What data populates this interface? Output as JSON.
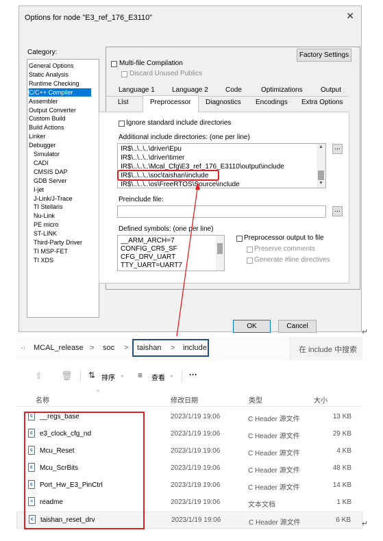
{
  "dialog": {
    "title": "Options for node \"E3_ref_176_E3110\"",
    "category_label": "Category:",
    "categories": [
      {
        "label": "General Options",
        "sub": false
      },
      {
        "label": "Static Analysis",
        "sub": false
      },
      {
        "label": "Runtime Checking",
        "sub": false
      },
      {
        "label": "C/C++ Compiler",
        "sub": false,
        "selected": true
      },
      {
        "label": "Assembler",
        "sub": false
      },
      {
        "label": "Output Converter",
        "sub": false
      },
      {
        "label": "Custom Build",
        "sub": false
      },
      {
        "label": "Build Actions",
        "sub": false
      },
      {
        "label": "Linker",
        "sub": false
      },
      {
        "label": "Debugger",
        "sub": false
      },
      {
        "label": "Simulator",
        "sub": true
      },
      {
        "label": "CADI",
        "sub": true
      },
      {
        "label": "CMSIS DAP",
        "sub": true
      },
      {
        "label": "GDB Server",
        "sub": true
      },
      {
        "label": "I-jet",
        "sub": true
      },
      {
        "label": "J-Link/J-Trace",
        "sub": true
      },
      {
        "label": "TI Stellaris",
        "sub": true
      },
      {
        "label": "Nu-Link",
        "sub": true
      },
      {
        "label": "PE micro",
        "sub": true
      },
      {
        "label": "ST-LINK",
        "sub": true
      },
      {
        "label": "Third-Party Driver",
        "sub": true
      },
      {
        "label": "TI MSP-FET",
        "sub": true
      },
      {
        "label": "TI XDS",
        "sub": true
      }
    ],
    "factory_settings": "Factory Settings",
    "multi_file": "Multi-file Compilation",
    "discard_unused": "Discard Unused Publics",
    "tabs_row1": [
      "Language 1",
      "Language 2",
      "Code",
      "Optimizations",
      "Output"
    ],
    "tabs_row2": [
      "List",
      "Preprocessor",
      "Diagnostics",
      "Encodings",
      "Extra Options"
    ],
    "ignore_std": "Ignore standard include directories",
    "include_label": "Additional include directories: (one per line)",
    "include_lines": [
      "IR$\\..\\..\\..\\driver\\Epu",
      "IR$\\..\\..\\..\\driver\\timer",
      "IR$\\..\\..\\..\\Mcal_Cfg\\E3_ref_176_E3110\\output\\include",
      "IR$\\..\\..\\..\\soc\\taishan\\include",
      "IR$\\..\\..\\..\\os\\FreeRTOS\\Source\\include"
    ],
    "ellipsis": "...",
    "preinclude_label": "Preinclude file:",
    "defined_label": "Defined symbols: (one per line)",
    "defined_lines": [
      "__ARM_ARCH=7",
      "CONFIG_CR5_SF",
      "CFG_DRV_UART",
      "TTY_UART=UART7"
    ],
    "pp_output": "Preprocessor output to file",
    "preserve_comments": "Preserve comments",
    "generate_line": "Generate #line directives",
    "ok": "OK",
    "cancel": "Cancel"
  },
  "explorer": {
    "breadcrumb": [
      "MCAL_release",
      "soc",
      "taishan",
      "include"
    ],
    "breadcrumb_more": "··",
    "separator": ">",
    "search_placeholder": "在 include 中搜索",
    "toolbar": {
      "sort": "排序",
      "view": "查看",
      "more": "···"
    },
    "columns": {
      "name": "名称",
      "date": "修改日期",
      "type": "类型",
      "size": "大小"
    },
    "files": [
      {
        "name": "__regs_base",
        "date": "2023/1/19 19:06",
        "type": "C Header 源文件",
        "size": "13 KB",
        "icon": "c-file-icon"
      },
      {
        "name": "e3_clock_cfg_nd",
        "date": "2023/1/19 19:06",
        "type": "C Header 源文件",
        "size": "29 KB",
        "icon": "c-file-icon"
      },
      {
        "name": "Mcu_Reset",
        "date": "2023/1/19 19:06",
        "type": "C Header 源文件",
        "size": "4 KB",
        "icon": "c-file-icon"
      },
      {
        "name": "Mcu_ScrBits",
        "date": "2023/1/19 19:06",
        "type": "C Header 源文件",
        "size": "48 KB",
        "icon": "c-file-icon"
      },
      {
        "name": "Port_Hw_E3_PinCtrl",
        "date": "2023/1/19 19:06",
        "type": "C Header 源文件",
        "size": "14 KB",
        "icon": "c-file-icon"
      },
      {
        "name": "readme",
        "date": "2023/1/19 19:06",
        "type": "文本文档",
        "size": "1 KB",
        "icon": "text-file-icon"
      },
      {
        "name": "taishan_reset_drv",
        "date": "2023/1/19 19:06",
        "type": "C Header 源文件",
        "size": "6 KB",
        "icon": "c-file-icon"
      }
    ]
  },
  "colors": {
    "highlight_red": "#e02020",
    "select_blue": "#0078d7",
    "breadcrumb_box": "#1f4e8c"
  }
}
